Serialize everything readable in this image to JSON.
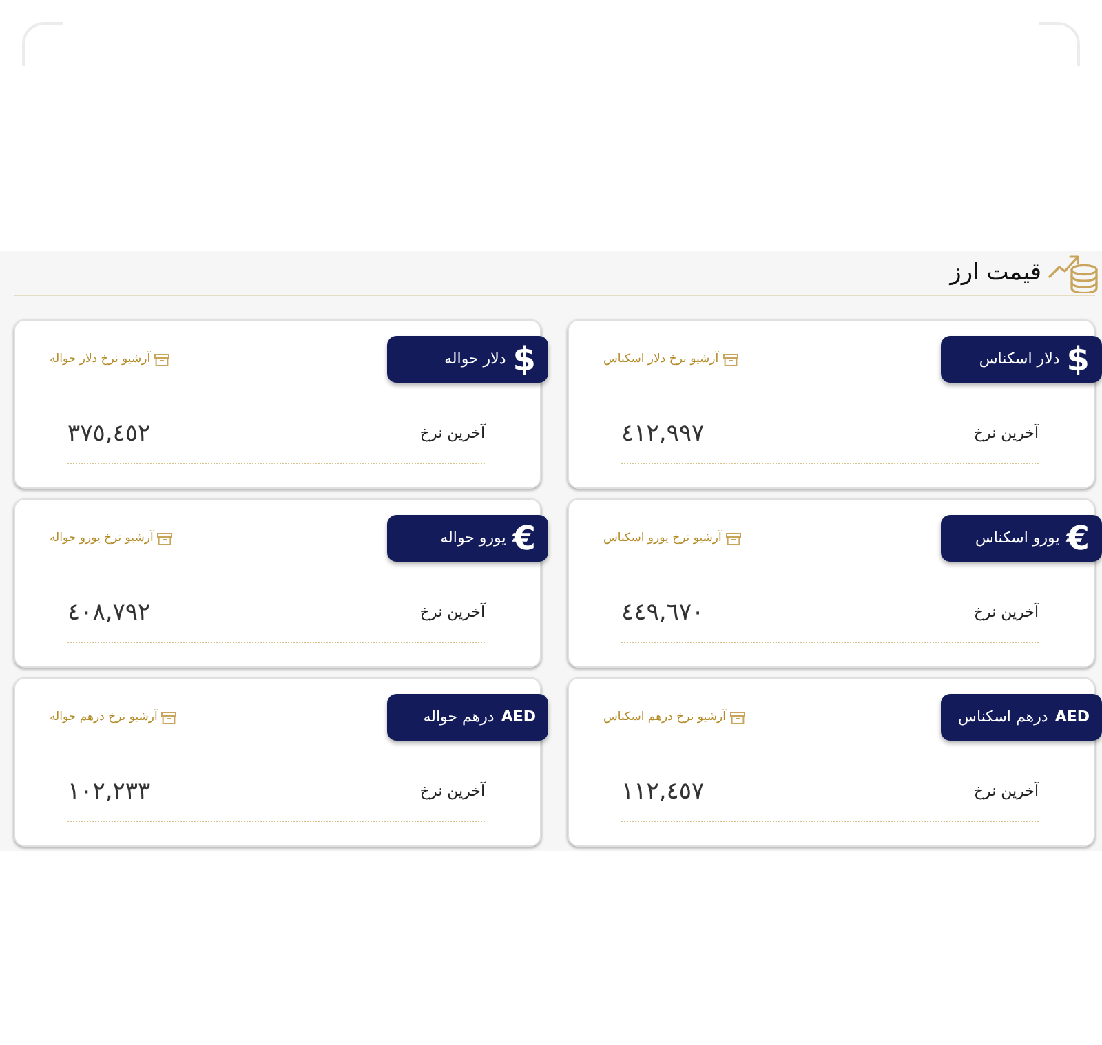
{
  "section": {
    "title": "قیمت ارز"
  },
  "cards": [
    {
      "title": "دلار اسکناس",
      "kind": "sign",
      "symbol": "$",
      "archive_link": "آرشیو نرخ دلار اسکناس",
      "rate_label": "آخرین نرخ",
      "rate": "٤١٢,٩٩٧"
    },
    {
      "title": "دلار حواله",
      "kind": "sign",
      "symbol": "$",
      "archive_link": "آرشیو نرخ دلار حواله",
      "rate_label": "آخرین نرخ",
      "rate": "٣٧٥,٤٥٢"
    },
    {
      "title": "یورو اسکناس",
      "kind": "sign",
      "symbol": "€",
      "archive_link": "آرشیو نرخ یورو اسکناس",
      "rate_label": "آخرین نرخ",
      "rate": "٤٤٩,٦٧٠"
    },
    {
      "title": "یورو حواله",
      "kind": "sign",
      "symbol": "€",
      "archive_link": "آرشیو نرخ یورو حواله",
      "rate_label": "آخرین نرخ",
      "rate": "٤٠٨,٧٩٢"
    },
    {
      "title": "درهم اسکناس",
      "kind": "code",
      "symbol": "AED",
      "archive_link": "آرشیو نرخ درهم اسکناس",
      "rate_label": "آخرین نرخ",
      "rate": "١١٢,٤٥٧"
    },
    {
      "title": "درهم حواله",
      "kind": "code",
      "symbol": "AED",
      "archive_link": "آرشیو نرخ درهم حواله",
      "rate_label": "آخرین نرخ",
      "rate": "١٠٢,٢٣٣"
    }
  ]
}
